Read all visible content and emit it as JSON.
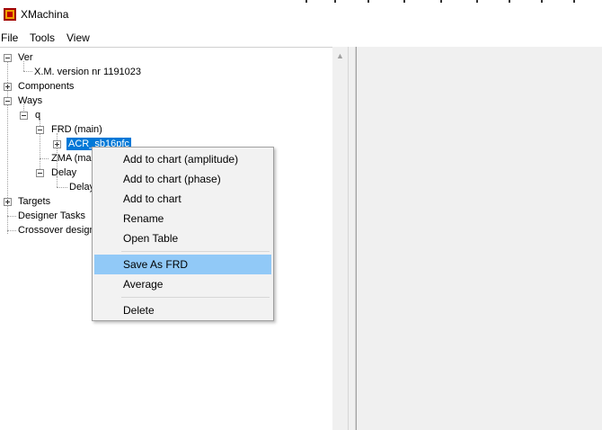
{
  "window": {
    "title": "XMachina"
  },
  "menubar": {
    "items": [
      "File",
      "Tools",
      "View"
    ]
  },
  "tree": {
    "root": "Ver",
    "version": "X.M. version nr 1191023",
    "components": "Components",
    "ways": "Ways",
    "q": "q",
    "frd": "FRD (main)",
    "acr": "ACR_sb16pfc",
    "zma": "ZMA (ma",
    "delay": "Delay",
    "delay_child": "Delay",
    "targets": "Targets",
    "designer_tasks": "Designer Tasks",
    "crossover": "Crossover design"
  },
  "context_menu": {
    "items": [
      "Add to chart (amplitude)",
      "Add to chart (phase)",
      "Add to chart",
      "Rename",
      "Open Table",
      "Save As FRD",
      "Average",
      "Delete"
    ],
    "highlighted_index": 5
  },
  "icons": {
    "app": "xmachina-app-icon",
    "scroll_up": "scroll-up-arrow-icon"
  },
  "colors": {
    "selection": "#0078d7",
    "menu_highlight": "#91c9f7",
    "panel_bg": "#f0f0f0"
  }
}
